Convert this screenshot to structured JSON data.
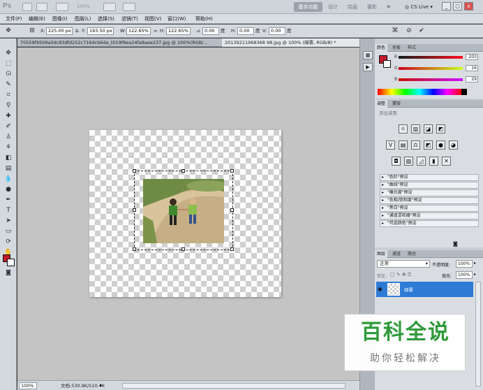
{
  "app": {
    "logo": "Ps",
    "zoom_select": "100%",
    "workspaces": [
      "基本功能",
      "设计",
      "绘画",
      "摄影"
    ],
    "more": "»",
    "cs_live": "CS Live",
    "win_buttons": [
      "_",
      "□",
      "x"
    ]
  },
  "menu": [
    "文件(F)",
    "编辑(E)",
    "图像(I)",
    "图层(L)",
    "选择(S)",
    "滤镜(T)",
    "视图(V)",
    "窗口(W)",
    "帮助(H)"
  ],
  "options": {
    "x_label": "X:",
    "x_value": "225.00 px",
    "y_label": "Y:",
    "y_value": "193.50 px",
    "w_label": "W:",
    "w_value": "122.65%",
    "h_label": "H:",
    "h_value": "122.65%",
    "angle_value": "0.00",
    "angle_unit": "度",
    "hskew_label": "H:",
    "hskew_value": "0.00",
    "hskew_unit": "度",
    "vskew_label": "V:",
    "vskew_value": "0.00",
    "vskew_unit": "度"
  },
  "tabs": [
    {
      "label": "70559f9509a0dc83dfd252c7164cb6da_t019f8ea24fa8aee237.jpg @ 100%(RGB/...",
      "active": false
    },
    {
      "label": "20139211968368 98.jpg @ 100% (邮票, RGB/8) *",
      "active": true
    }
  ],
  "status": {
    "zoom": "100%",
    "doc": "文档:530.9K/510.4K"
  },
  "panels": {
    "color_tabs": [
      "颜色",
      "色板",
      "样式"
    ],
    "color": {
      "fg": "#c21a2a",
      "r": "203",
      "g": "16",
      "b": "29"
    },
    "adjust_tabs": [
      "调整",
      "蒙版"
    ],
    "adjust_title": "添加调整",
    "presets": [
      "\"色阶\"预设",
      "\"曲线\"预设",
      "\"曝光度\"预设",
      "\"色相/饱和度\"预设",
      "\"黑白\"预设",
      "\"通道混和器\"预设",
      "\"可选颜色\"预设"
    ],
    "layers_tabs": [
      "图层",
      "通道",
      "路径"
    ],
    "blend_mode": "正常",
    "opacity_label": "不透明度:",
    "opacity": "100%",
    "lock_label": "锁定:",
    "fill_label": "填充:",
    "fill": "100%",
    "layer_name": "邮票"
  },
  "watermark": {
    "title": "百科全说",
    "subtitle": "助你轻松解决"
  }
}
